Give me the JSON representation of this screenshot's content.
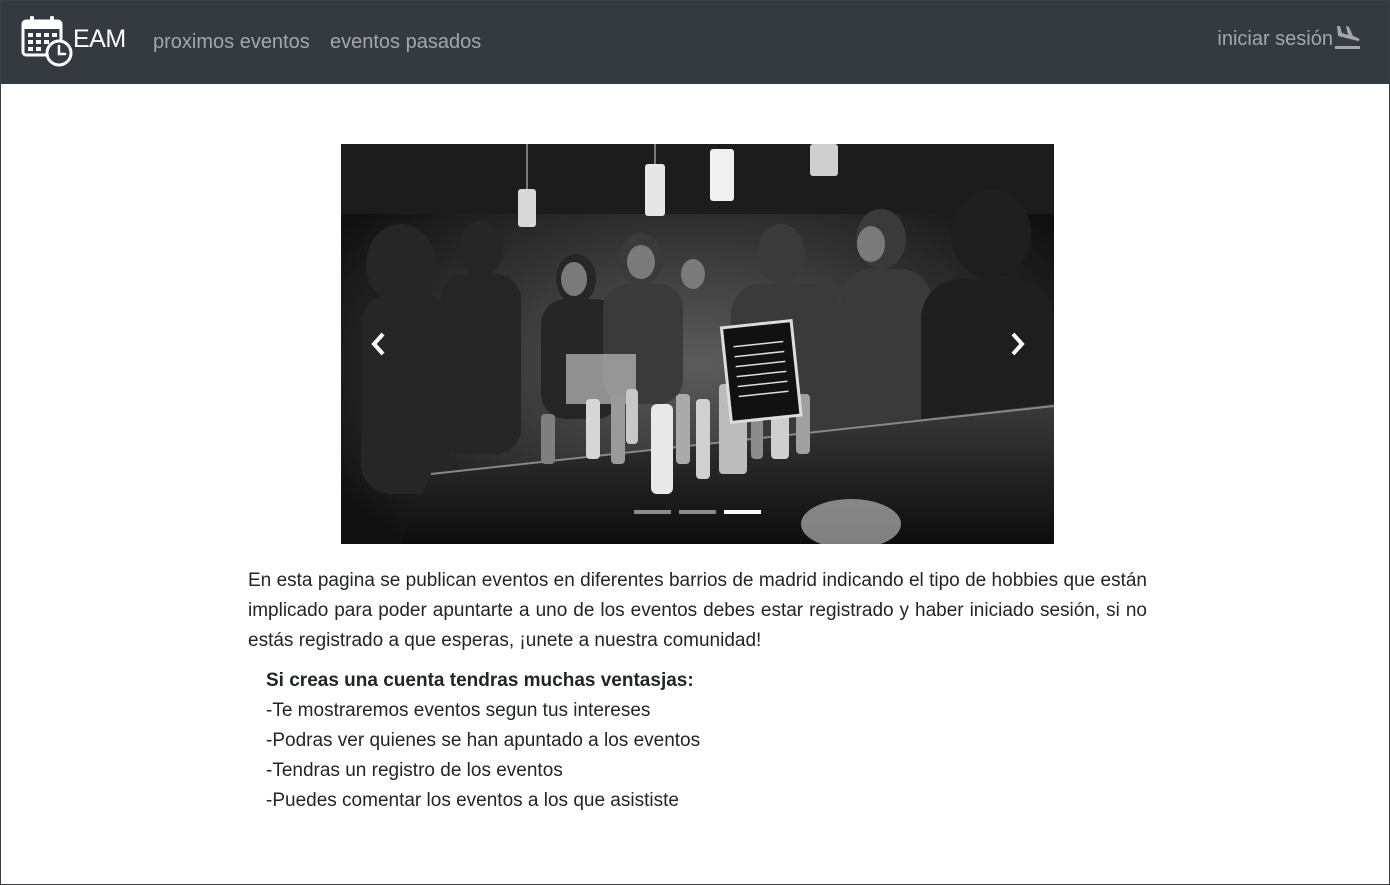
{
  "navbar": {
    "brand": "EAM",
    "links": [
      "proximos eventos",
      "eventos pasados"
    ],
    "login_label": "iniciar sesión"
  },
  "carousel": {
    "active_slide": 3,
    "slide_count": 3
  },
  "content": {
    "intro": "En esta pagina se publican eventos en diferentes barrios de madrid indicando el tipo de hobbies que están implicado para poder apuntarte a uno de los eventos debes estar registrado y haber iniciado sesión, si no estás registrado a que esperas, ¡unete a nuestra comunidad!",
    "benefits_heading": "Si creas una cuenta tendras muchas ventasjas:",
    "benefits": [
      "-Te mostraremos eventos segun tus intereses",
      "-Podras ver quienes se han apuntado a los eventos",
      "-Tendras un registro de los eventos",
      "-Puedes comentar los eventos a los que asististe"
    ]
  },
  "colors": {
    "navbar_bg": "#343a40",
    "nav_link": "rgba(255,255,255,0.55)",
    "text": "#212529"
  },
  "icons": {
    "brand": "calendar-clock-icon",
    "login": "plane-landing-icon",
    "prev": "chevron-left-icon",
    "next": "chevron-right-icon"
  }
}
